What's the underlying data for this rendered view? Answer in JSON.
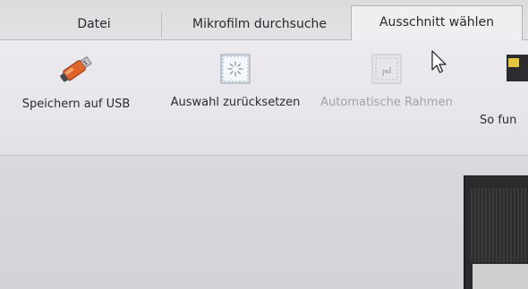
{
  "tabs": [
    {
      "label": "Datei",
      "active": false
    },
    {
      "label": "Mikrofilm durchsuche",
      "active": false
    },
    {
      "label": "Ausschnitt wählen",
      "active": true
    }
  ],
  "ribbon": {
    "buttons": [
      {
        "label": "Speichern auf USB",
        "icon": "usb-stick-icon",
        "enabled": true
      },
      {
        "label": "Auswahl zurücksetzen",
        "icon": "reset-selection-icon",
        "enabled": true
      },
      {
        "label": "Automatische Rahmen",
        "icon": "auto-frame-icon",
        "enabled": false
      },
      {
        "label": "So fun",
        "icon": "help-book-icon",
        "enabled": true
      }
    ]
  },
  "colors": {
    "usb_body": "#e0632a",
    "text": "#2c2c30",
    "disabled_text": "#a3a2a8",
    "preview_bg": "#2b2b2e"
  }
}
